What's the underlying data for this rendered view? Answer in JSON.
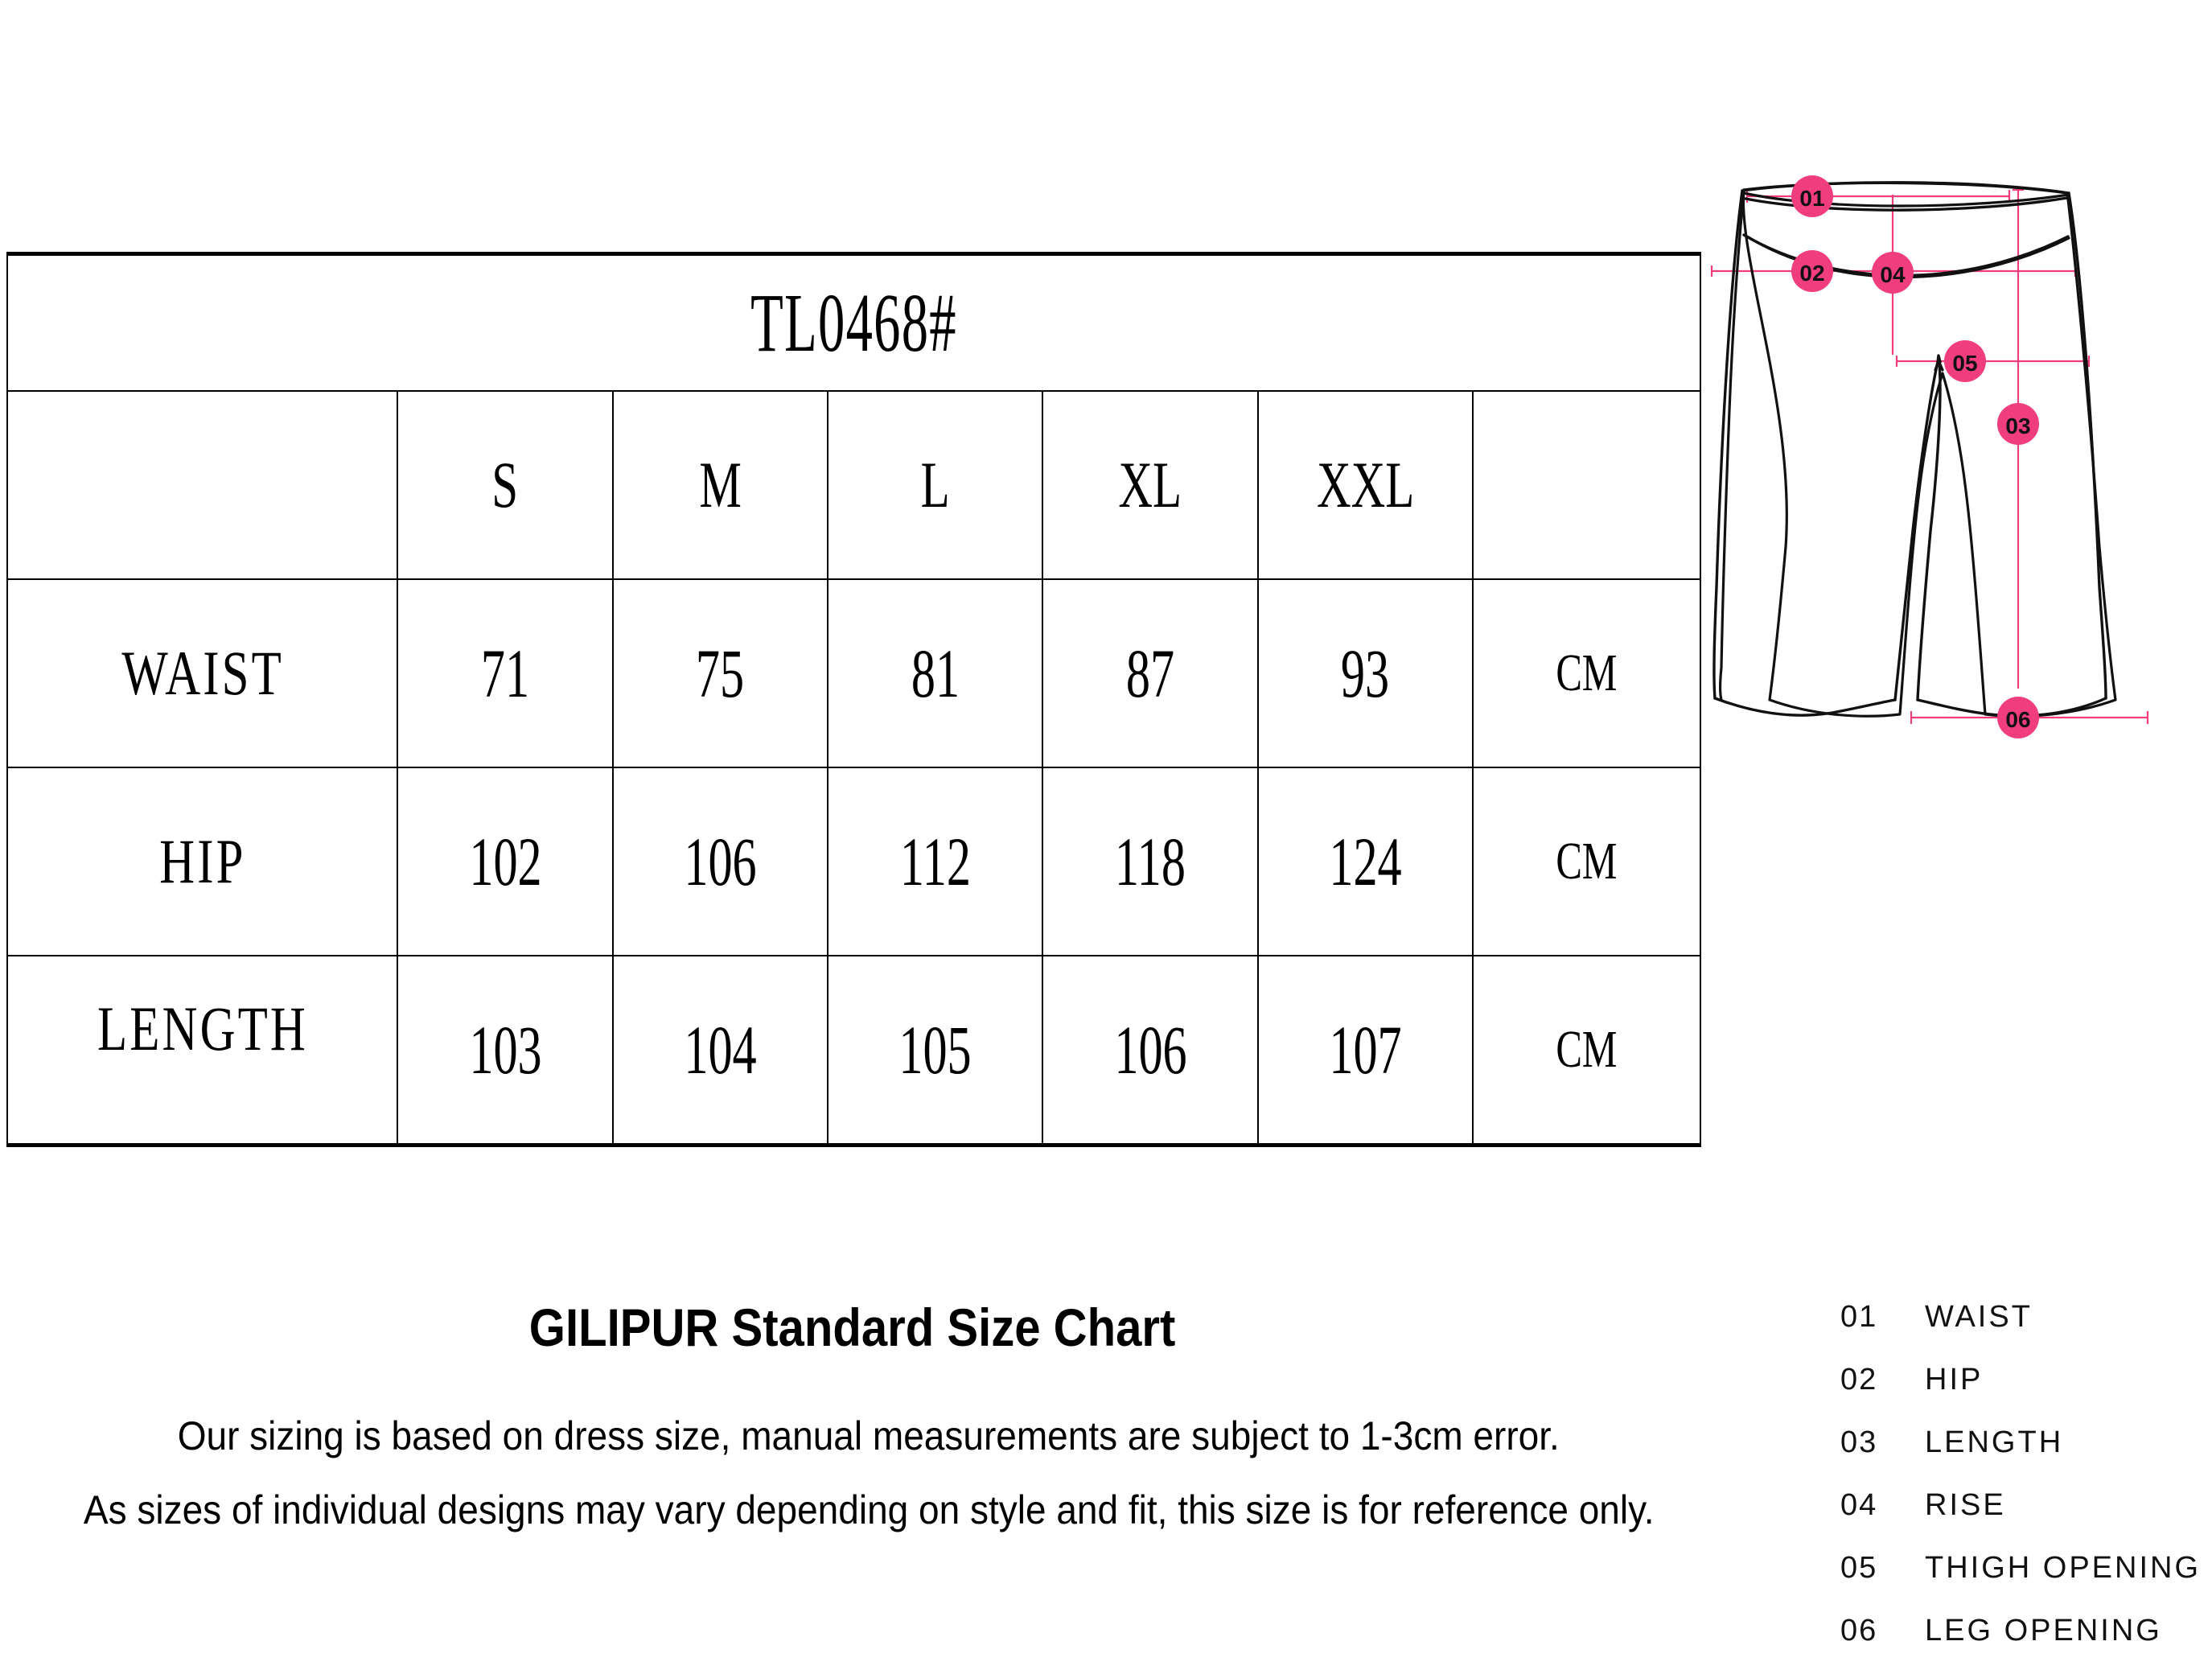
{
  "table": {
    "title": "TL0468#",
    "size_headers": [
      "",
      "S",
      "M",
      "L",
      "XL",
      "XXL",
      ""
    ],
    "rows": [
      {
        "label": "WAIST",
        "values": [
          "71",
          "75",
          "81",
          "87",
          "93"
        ],
        "unit": "CM"
      },
      {
        "label": "HIP",
        "values": [
          "102",
          "106",
          "112",
          "118",
          "124"
        ],
        "unit": "CM"
      },
      {
        "label": "LENGTH",
        "values": [
          "103",
          "104",
          "105",
          "106",
          "107"
        ],
        "unit": "CM"
      }
    ],
    "highlight_color": "#e60012",
    "highlight_size": "S"
  },
  "brand": {
    "title": "GILIPUR Standard Size Chart",
    "disclaimer_line_1": "Our sizing is based on dress size, manual measurements are subject to 1-3cm error.",
    "disclaimer_line_2": "As sizes of individual designs may vary depending on style and fit, this size is for reference only."
  },
  "legend": {
    "accent_color": "#ef3d7e",
    "items": [
      {
        "num": "01",
        "label": "WAIST"
      },
      {
        "num": "02",
        "label": "HIP"
      },
      {
        "num": "03",
        "label": "LENGTH"
      },
      {
        "num": "04",
        "label": "RISE"
      },
      {
        "num": "05",
        "label": "THIGH OPENING"
      },
      {
        "num": "06",
        "label": "LEG OPENING"
      }
    ]
  },
  "diagram": {
    "markers": [
      "01",
      "02",
      "03",
      "04",
      "05",
      "06"
    ],
    "garment": "wide-leg-pants"
  }
}
